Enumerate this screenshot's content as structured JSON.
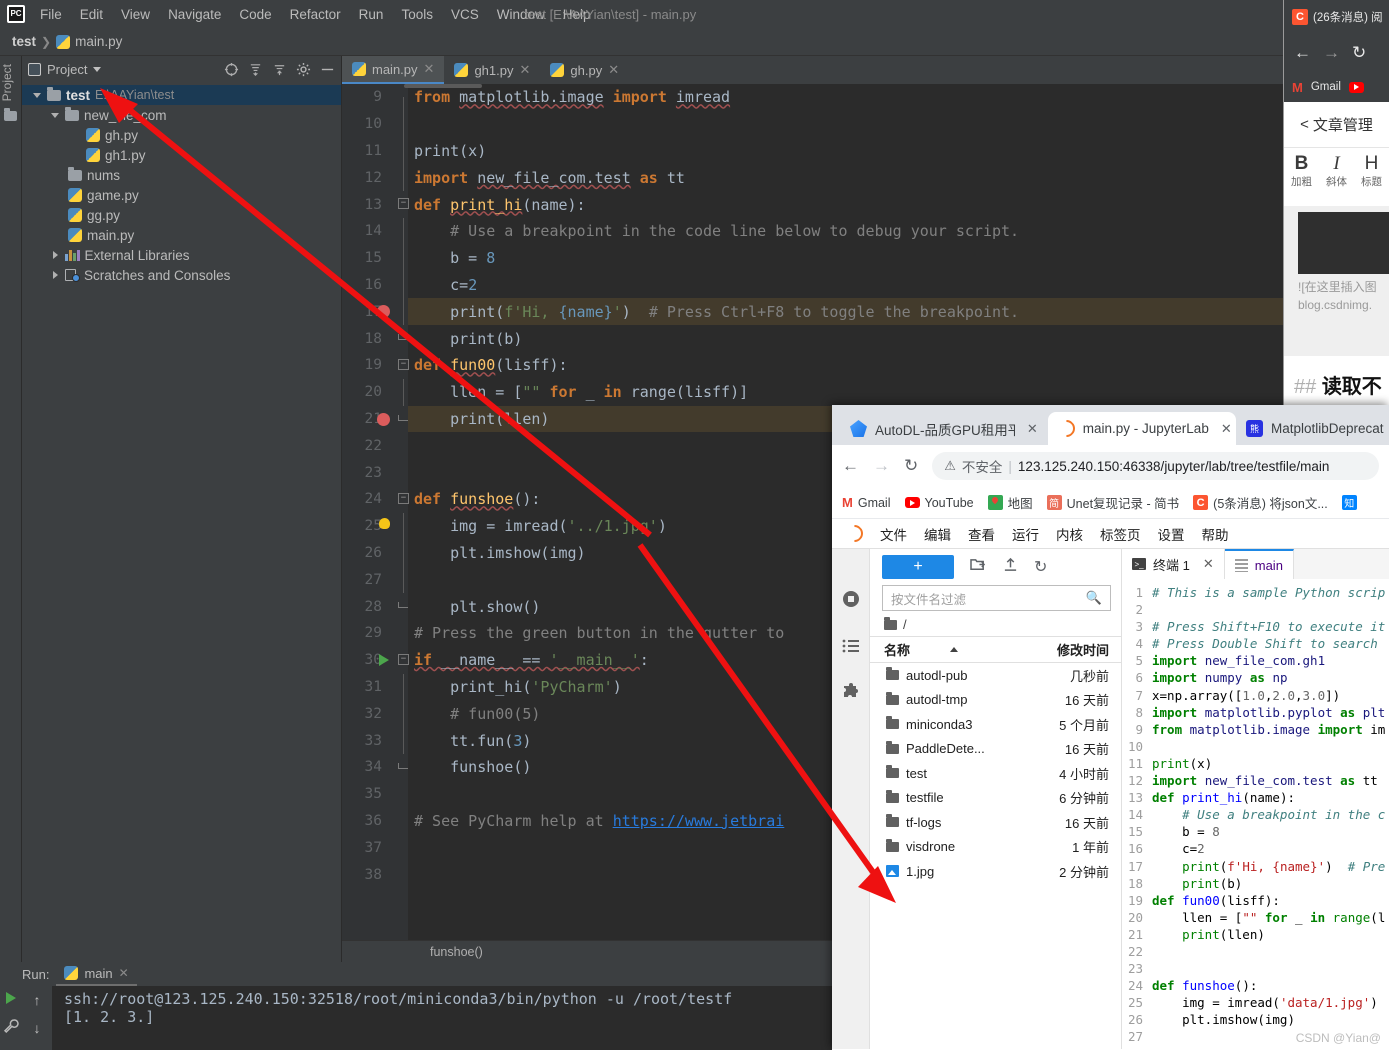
{
  "pycharm": {
    "logo": "PC",
    "menu": [
      "File",
      "Edit",
      "View",
      "Navigate",
      "Code",
      "Refactor",
      "Run",
      "Tools",
      "VCS",
      "Window",
      "Help"
    ],
    "window_title": "test [E:\\AAYian\\test] - main.py",
    "breadcrumb": {
      "project": "test",
      "file": "main.py"
    },
    "left_strip_label": "Project",
    "project_panel": {
      "title": "Project",
      "tree": [
        {
          "label": "test",
          "path": "E:\\AAYian\\test",
          "type": "folder-open",
          "depth": 0,
          "selected": true
        },
        {
          "label": "new_file_com",
          "path": "",
          "type": "folder-open",
          "depth": 1,
          "selected": false
        },
        {
          "label": "gh.py",
          "path": "",
          "type": "python",
          "depth": 2,
          "selected": false
        },
        {
          "label": "gh1.py",
          "path": "",
          "type": "python",
          "depth": 2,
          "selected": false
        },
        {
          "label": "nums",
          "path": "",
          "type": "folder",
          "depth": 1,
          "selected": false
        },
        {
          "label": "game.py",
          "path": "",
          "type": "python",
          "depth": 1,
          "selected": false
        },
        {
          "label": "gg.py",
          "path": "",
          "type": "python",
          "depth": 1,
          "selected": false
        },
        {
          "label": "main.py",
          "path": "",
          "type": "python",
          "depth": 1,
          "selected": false
        },
        {
          "label": "External Libraries",
          "path": "",
          "type": "libraries",
          "depth": 0,
          "selected": false
        },
        {
          "label": "Scratches and Consoles",
          "path": "",
          "type": "scratches",
          "depth": 0,
          "selected": false
        }
      ]
    },
    "editor_tabs": [
      {
        "label": "main.py",
        "active": true
      },
      {
        "label": "gh1.py",
        "active": false
      },
      {
        "label": "gh.py",
        "active": false
      }
    ],
    "editor_lines": [
      {
        "n": 9,
        "marker": "",
        "fold": "start"
      },
      {
        "n": 10,
        "marker": "",
        "fold": ""
      },
      {
        "n": 11,
        "marker": "",
        "fold": ""
      },
      {
        "n": 12,
        "marker": "",
        "fold": ""
      },
      {
        "n": 13,
        "marker": "",
        "fold": "start"
      },
      {
        "n": 14,
        "marker": "",
        "fold": ""
      },
      {
        "n": 15,
        "marker": "",
        "fold": ""
      },
      {
        "n": 16,
        "marker": "",
        "fold": ""
      },
      {
        "n": 17,
        "marker": "breakpoint",
        "fold": ""
      },
      {
        "n": 18,
        "marker": "",
        "fold": "end"
      },
      {
        "n": 19,
        "marker": "",
        "fold": "start"
      },
      {
        "n": 20,
        "marker": "",
        "fold": ""
      },
      {
        "n": 21,
        "marker": "breakpoint",
        "fold": "end"
      },
      {
        "n": 22,
        "marker": "",
        "fold": ""
      },
      {
        "n": 23,
        "marker": "",
        "fold": ""
      },
      {
        "n": 24,
        "marker": "",
        "fold": "start"
      },
      {
        "n": 25,
        "marker": "bulb",
        "fold": ""
      },
      {
        "n": 26,
        "marker": "",
        "fold": ""
      },
      {
        "n": 27,
        "marker": "",
        "fold": ""
      },
      {
        "n": 28,
        "marker": "",
        "fold": "end"
      },
      {
        "n": 29,
        "marker": "",
        "fold": ""
      },
      {
        "n": 30,
        "marker": "run",
        "fold": "start"
      },
      {
        "n": 31,
        "marker": "",
        "fold": ""
      },
      {
        "n": 32,
        "marker": "",
        "fold": ""
      },
      {
        "n": 33,
        "marker": "",
        "fold": ""
      },
      {
        "n": 34,
        "marker": "",
        "fold": "end"
      },
      {
        "n": 35,
        "marker": "",
        "fold": ""
      },
      {
        "n": 36,
        "marker": "",
        "fold": ""
      },
      {
        "n": 37,
        "marker": "",
        "fold": ""
      },
      {
        "n": 38,
        "marker": "",
        "fold": ""
      }
    ],
    "editor_code_plain": [
      "from matplotlib.image import imread",
      "",
      "print(x)",
      "import new_file_com.test as tt",
      "def print_hi(name):",
      "    # Use a breakpoint in the code line below to debug your script.",
      "    b = 8",
      "    c=2",
      "    print(f'Hi, {name}')  # Press Ctrl+F8 to toggle the breakpoint.",
      "    print(b)",
      "def fun00(lisff):",
      "    llen = [\"\" for _ in range(lisff)]",
      "    print(llen)",
      "",
      "",
      "def funshoe():",
      "    img = imread('../1.jpg')",
      "    plt.imshow(img)",
      "",
      "    plt.show()",
      "# Press the green button in the gutter to",
      "if __name__ == '__main__':",
      "    print_hi('PyCharm')",
      "    # fun00(5)",
      "    tt.fun(3)",
      "    funshoe()",
      "",
      "# See PyCharm help at https://www.jetbrai",
      "",
      ""
    ],
    "editor_footer": "funshoe()",
    "run_panel": {
      "label": "Run:",
      "tab": "main",
      "lines": [
        "ssh://root@123.125.240.150:32518/root/miniconda3/bin/python -u /root/testf",
        "[1. 2. 3.]"
      ]
    }
  },
  "csdn": {
    "tab_title": "(26条消息) 阅",
    "sub_title": "文章管理",
    "back_chevron": "<",
    "bookmarks": [
      "Gmail"
    ],
    "tools": [
      {
        "big": "B",
        "sm": "加粗"
      },
      {
        "big": "I",
        "sm": "斜体"
      },
      {
        "big": "H",
        "sm": "标题"
      }
    ],
    "editor_text": [
      "![在这里插入图",
      "blog.csdnimg."
    ],
    "heading_hash": "##",
    "heading_text": "读取不"
  },
  "chrome": {
    "tabs": [
      {
        "label": "AutoDL-品质GPU租用平",
        "icon": "autodl-favicon",
        "active": false
      },
      {
        "label": "main.py - JupyterLab",
        "icon": "jupyter-favicon",
        "active": true
      },
      {
        "label": "MatplotlibDeprecat",
        "icon": "baidu-favicon",
        "active": false
      }
    ],
    "nav": {
      "back": "←",
      "forward": "→",
      "reload": "C"
    },
    "security_label": "不安全",
    "url": "123.125.240.150:46338/jupyter/lab/tree/testfile/main",
    "bookmarks": [
      {
        "label": "Gmail",
        "icon": "gmail-icon"
      },
      {
        "label": "YouTube",
        "icon": "youtube-icon"
      },
      {
        "label": "地图",
        "icon": "maps-icon"
      },
      {
        "label": "Unet复现记录 - 简书",
        "icon": "jianshu-icon"
      },
      {
        "label": "(5条消息) 将json文...",
        "icon": "csdn-icon"
      },
      {
        "label": "知",
        "icon": "zhihu-icon"
      }
    ]
  },
  "jupyter": {
    "menu": [
      "文件",
      "编辑",
      "查看",
      "运行",
      "内核",
      "标签页",
      "设置",
      "帮助"
    ],
    "rail_icons": [
      "folder-icon",
      "running-icon",
      "commands-icon",
      "extensions-icon"
    ],
    "file_browser": {
      "new_button": "+",
      "toolbar_icons": [
        "new-folder-icon",
        "upload-icon",
        "refresh-icon"
      ],
      "filter_placeholder": "按文件名过滤",
      "breadcrumb": "/",
      "columns": [
        "名称",
        "修改时间"
      ],
      "rows": [
        {
          "name": "autodl-pub",
          "time": "几秒前",
          "type": "folder"
        },
        {
          "name": "autodl-tmp",
          "time": "16 天前",
          "type": "folder"
        },
        {
          "name": "miniconda3",
          "time": "5 个月前",
          "type": "folder"
        },
        {
          "name": "PaddleDete...",
          "time": "16 天前",
          "type": "folder"
        },
        {
          "name": "test",
          "time": "4 小时前",
          "type": "folder"
        },
        {
          "name": "testfile",
          "time": "6 分钟前",
          "type": "folder"
        },
        {
          "name": "tf-logs",
          "time": "16 天前",
          "type": "folder"
        },
        {
          "name": "visdrone",
          "time": "1 年前",
          "type": "folder"
        },
        {
          "name": "1.jpg",
          "time": "2 分钟前",
          "type": "image"
        }
      ]
    },
    "tabs": [
      {
        "label": "终端 1",
        "icon": "terminal-icon",
        "active": false,
        "closable": true
      },
      {
        "label": "main",
        "icon": "document-icon",
        "active": true,
        "closable": false
      }
    ],
    "code_lines": [
      {
        "n": 1,
        "text": "# This is a sample Python scrip"
      },
      {
        "n": 2,
        "text": ""
      },
      {
        "n": 3,
        "text": "# Press Shift+F10 to execute it"
      },
      {
        "n": 4,
        "text": "# Press Double Shift to search"
      },
      {
        "n": 5,
        "text": "import new_file_com.gh1"
      },
      {
        "n": 6,
        "text": "import numpy as np"
      },
      {
        "n": 7,
        "text": "x=np.array([1.0,2.0,3.0])"
      },
      {
        "n": 8,
        "text": "import matplotlib.pyplot as plt"
      },
      {
        "n": 9,
        "text": "from matplotlib.image import im"
      },
      {
        "n": 10,
        "text": ""
      },
      {
        "n": 11,
        "text": "print(x)"
      },
      {
        "n": 12,
        "text": "import new_file_com.test as tt"
      },
      {
        "n": 13,
        "text": "def print_hi(name):"
      },
      {
        "n": 14,
        "text": "    # Use a breakpoint in the c"
      },
      {
        "n": 15,
        "text": "    b = 8"
      },
      {
        "n": 16,
        "text": "    c=2"
      },
      {
        "n": 17,
        "text": "    print(f'Hi, {name}')  # Pre"
      },
      {
        "n": 18,
        "text": "    print(b)"
      },
      {
        "n": 19,
        "text": "def fun00(lisff):"
      },
      {
        "n": 20,
        "text": "    llen = [\"\" for _ in range(l"
      },
      {
        "n": 21,
        "text": "    print(llen)"
      },
      {
        "n": 22,
        "text": ""
      },
      {
        "n": 23,
        "text": ""
      },
      {
        "n": 24,
        "text": "def funshoe():"
      },
      {
        "n": 25,
        "text": "    img = imread('data/1.jpg')"
      },
      {
        "n": 26,
        "text": "    plt.imshow(img)"
      },
      {
        "n": 27,
        "text": ""
      }
    ],
    "watermark": "CSDN @Yian@"
  },
  "annotations": {
    "arrow_color": "#ee1111",
    "arrows": 2
  }
}
